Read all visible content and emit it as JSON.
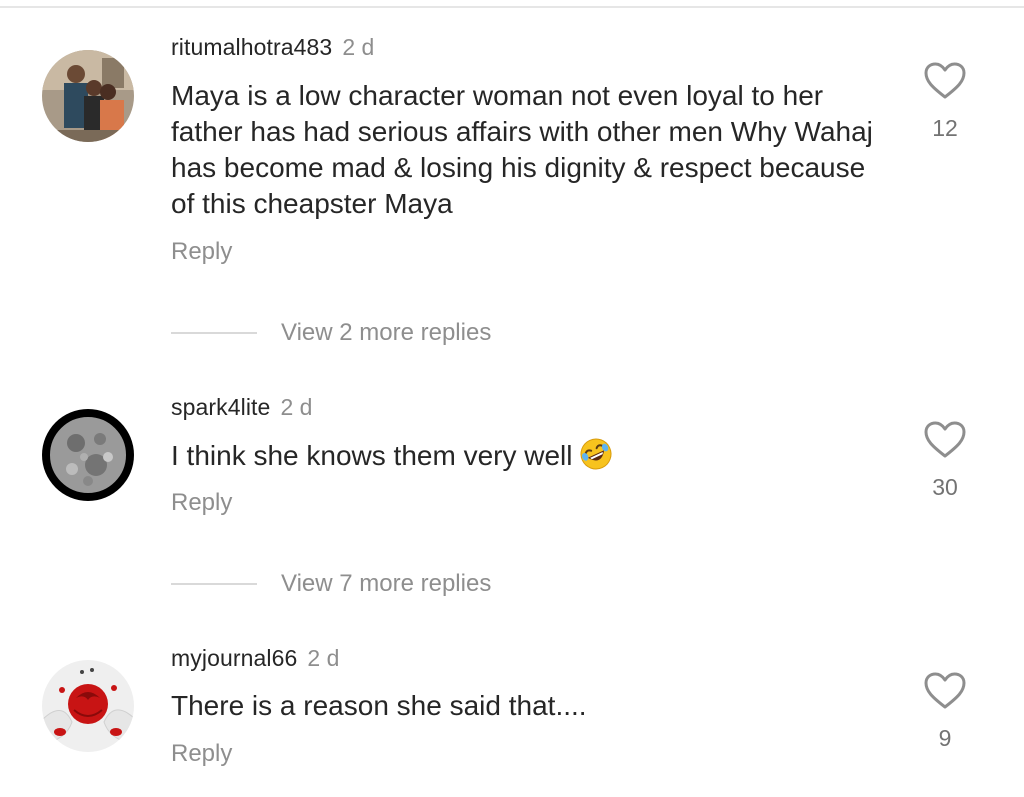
{
  "comments": [
    {
      "username": "ritumalhotra483",
      "time": "2 d",
      "text": "Maya is a low character woman not even loyal to her father has had serious affairs with other men Why Wahaj has become mad & losing his dignity & respect because of this cheapster Maya",
      "reply_label": "Reply",
      "likes": "12",
      "view_replies": "View 2 more replies"
    },
    {
      "username": "spark4lite",
      "time": "2 d",
      "text": "I think she knows them very well",
      "emoji": "rolling-on-floor-laughing-emoji",
      "reply_label": "Reply",
      "likes": "30",
      "view_replies": "View 7 more replies"
    },
    {
      "username": "myjournal66",
      "time": "2 d",
      "text": "There is a reason she said that....",
      "reply_label": "Reply",
      "likes": "9"
    }
  ],
  "colors": {
    "primary_text": "#262626",
    "secondary_text": "#8e8e8e",
    "divider": "#d9d9d9"
  }
}
